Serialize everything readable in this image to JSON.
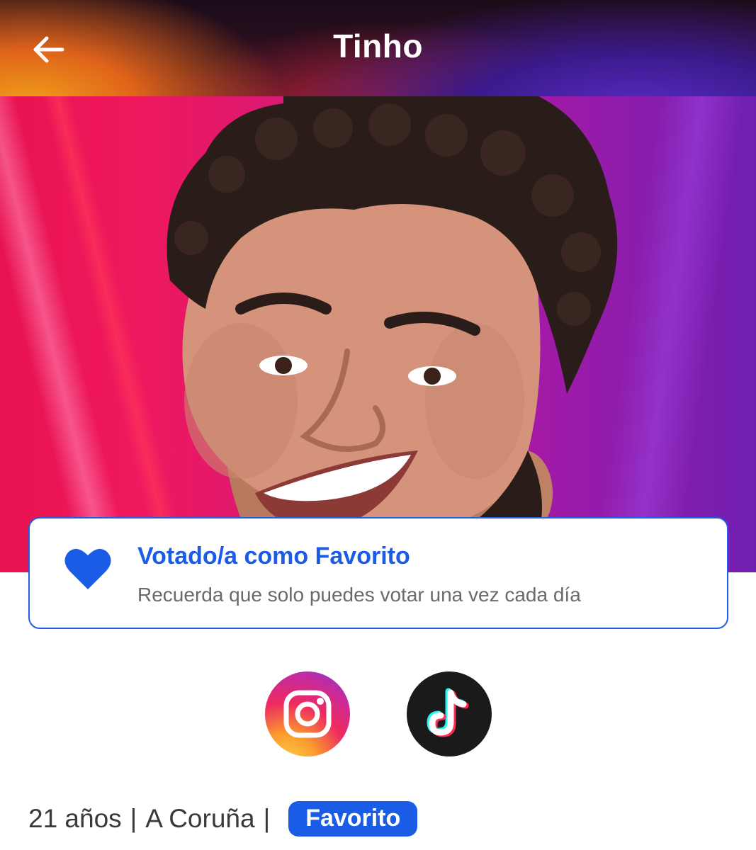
{
  "header": {
    "title": "Tinho",
    "back_icon": "arrow-left-icon"
  },
  "hero": {
    "image": "contestant-portrait",
    "background_colors": [
      "#e8124f",
      "#d01a7a",
      "#6f1fb0"
    ]
  },
  "vote_card": {
    "icon": "heart-icon",
    "title": "Votado/a como Favorito",
    "subtitle": "Recuerda que solo puedes votar una vez cada día",
    "accent_color": "#1a5ce6"
  },
  "socials": [
    {
      "icon": "instagram-icon"
    },
    {
      "icon": "tiktok-icon"
    }
  ],
  "info": {
    "age": "21 años",
    "separator": "|",
    "city": "A Coruña",
    "badge": "Favorito"
  }
}
